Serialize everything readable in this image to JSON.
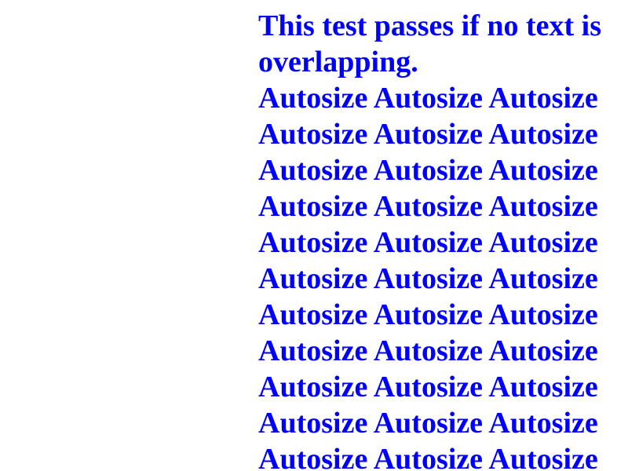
{
  "test_text": {
    "line_1": "This test passes if no text is",
    "line_2": "overlapping."
  },
  "autosize_lines": [
    "Autosize Autosize Autosize",
    "Autosize Autosize Autosize",
    "Autosize Autosize Autosize",
    "Autosize Autosize Autosize",
    "Autosize Autosize Autosize",
    "Autosize Autosize Autosize",
    "Autosize Autosize Autosize",
    "Autosize Autosize Autosize",
    "Autosize Autosize Autosize",
    "Autosize Autosize Autosize",
    "Autosize Autosize Autosize"
  ],
  "colors": {
    "text": "#0000ff",
    "background": "#ffffff"
  }
}
